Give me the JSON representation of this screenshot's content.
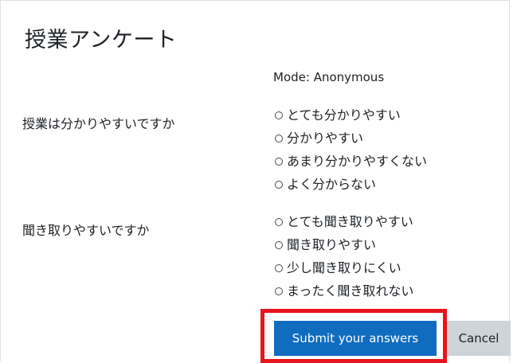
{
  "survey": {
    "title": "授業アンケート",
    "mode": "Mode: Anonymous"
  },
  "questions": [
    {
      "text": "授業は分かりやすいですか",
      "options": [
        "とても分かりやすい",
        "分かりやすい",
        "あまり分かりやすくない",
        "よく分からない"
      ]
    },
    {
      "text": "聞き取りやすいですか",
      "options": [
        "とても聞き取りやすい",
        "聞き取りやすい",
        "少し聞き取りにくい",
        "まったく聞き取れない"
      ]
    }
  ],
  "actions": {
    "submit_label": "Submit your answers",
    "cancel_label": "Cancel"
  },
  "colors": {
    "primary": "#0f6cbf",
    "secondary": "#ced4da",
    "highlight": "#e8141c"
  }
}
